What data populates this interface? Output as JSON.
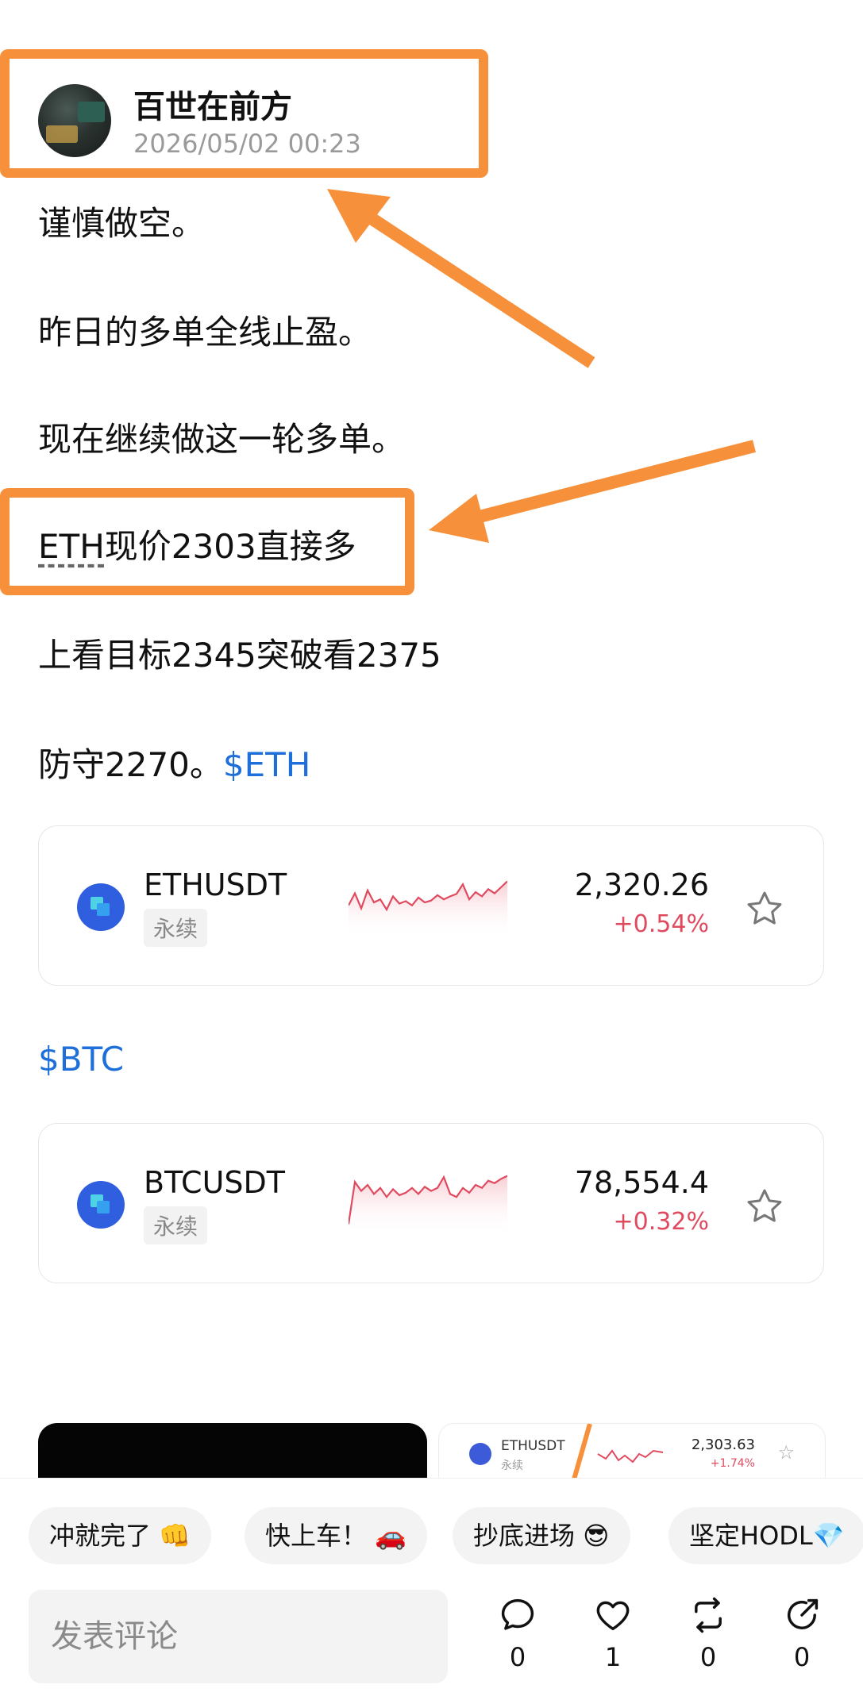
{
  "post": {
    "author": "百世在前方",
    "timestamp": "2026/05/02 00:23",
    "lines": [
      "谨慎做空。",
      "昨日的多单全线止盈。",
      "现在继续做这一轮多单。"
    ],
    "eth_line_symbol": "ETH",
    "eth_line_rest": "现价2303直接多",
    "target_line": "上看目标2345突破看2375",
    "defense_line": "防守2270。",
    "eth_tag": "$ETH",
    "btc_tag": "$BTC"
  },
  "markets": [
    {
      "symbol": "ETHUSDT",
      "type": "永续",
      "price": "2,320.26",
      "change": "+0.54%",
      "sparkline": [
        0.55,
        0.35,
        0.6,
        0.3,
        0.5,
        0.45,
        0.62,
        0.4,
        0.52,
        0.48,
        0.55,
        0.42,
        0.5,
        0.47,
        0.38,
        0.45,
        0.4,
        0.36,
        0.2,
        0.45,
        0.33,
        0.4,
        0.28,
        0.35,
        0.25,
        0.15
      ]
    },
    {
      "symbol": "BTCUSDT",
      "type": "永续",
      "price": "78,554.4",
      "change": "+0.32%",
      "sparkline": [
        0.9,
        0.2,
        0.35,
        0.25,
        0.4,
        0.3,
        0.45,
        0.32,
        0.42,
        0.38,
        0.3,
        0.4,
        0.28,
        0.35,
        0.3,
        0.12,
        0.4,
        0.45,
        0.3,
        0.38,
        0.25,
        0.3,
        0.18,
        0.22,
        0.15,
        0.1
      ]
    }
  ],
  "preview": {
    "symbol": "ETHUSDT",
    "type": "永续",
    "price": "2,303.63",
    "change": "+1.74%"
  },
  "quick_replies": [
    "冲就完了 👊",
    "快上车！ 🚗",
    "抄底进场 😎",
    "坚定HODL💎"
  ],
  "comment_placeholder": "发表评论",
  "actions": {
    "comments": "0",
    "likes": "1",
    "reposts": "0",
    "shares": "0"
  },
  "colors": {
    "accent": "#f7903a",
    "link": "#1e6fd9",
    "up": "#e04a5f"
  },
  "icons": [
    "comment-icon",
    "heart-icon",
    "repost-icon",
    "share-icon",
    "star-icon"
  ]
}
